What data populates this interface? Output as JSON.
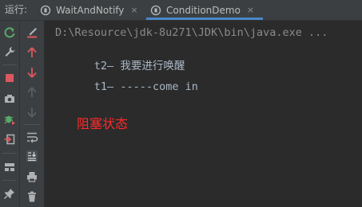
{
  "run_label": "运行:",
  "tabs": [
    {
      "label": "WaitAndNotify",
      "close": "×"
    },
    {
      "label": "ConditionDemo",
      "close": "×",
      "active": true
    }
  ],
  "toolbar_left": [
    "rerun-icon",
    "wrench-icon",
    "stop-icon",
    "camera-icon",
    "debug-bug-icon",
    "exit-icon",
    "layout-icon",
    "pin-icon"
  ],
  "toolbar_right": [
    "pencil-icon",
    "arrow-up-icon",
    "arrow-down-icon",
    "arrow-up-disabled-icon",
    "arrow-down-disabled-icon",
    "soft-wrap-icon",
    "scroll-to-end-icon",
    "print-icon",
    "trash-icon"
  ],
  "console": {
    "lines": [
      {
        "text": "D:\\Resource\\jdk-8u271\\JDK\\bin\\java.exe ..."
      },
      {
        "prefix": "t2",
        "dash": "—",
        "text": "我要进行唤醒"
      },
      {
        "prefix": "t1",
        "dash": "—",
        "text": "-----come in"
      }
    ],
    "annotation": "阻塞状态"
  },
  "colors": {
    "accent": "#4a88c7",
    "annotation": "#ff2a2a",
    "rerun": "#59a869",
    "stop": "#db5860",
    "arrow_red": "#db5860"
  }
}
